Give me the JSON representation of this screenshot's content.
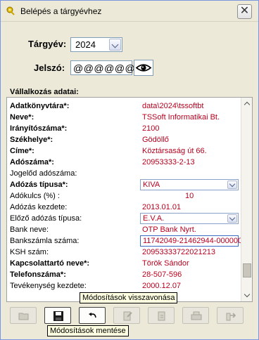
{
  "window": {
    "title": "Belépés a tárgyévhez",
    "close_label": "✕"
  },
  "login": {
    "year_label": "Tárgyév:",
    "year_value": "2024",
    "password_label": "Jelszó:",
    "password_value": "@@@@@@"
  },
  "company": {
    "section_label": "Vállalkozás adatai:",
    "fields": [
      {
        "label": "Adatkönyvtára*:",
        "value": "data\\2024\\tssoftbt"
      },
      {
        "label": "Neve*:",
        "value": "TSSoft Informatikai Bt."
      },
      {
        "label": "Irányítószáma*:",
        "value": "2100"
      },
      {
        "label": "Székhelye*:",
        "value": "Gödöllő"
      },
      {
        "label": "Címe*:",
        "value": "Köztársaság út 66."
      },
      {
        "label": "Adószáma*:",
        "value": "20953333-2-13"
      },
      {
        "label": "Jogelőd adószáma:",
        "value": ""
      },
      {
        "label": "Adózás típusa*:",
        "value": "KIVA"
      },
      {
        "label": "Adókulcs (%) :",
        "value": "10"
      },
      {
        "label": "Adózás kezdete:",
        "value": "2013.01.01"
      },
      {
        "label": "Előző adózás típusa:",
        "value": "E.V.A."
      },
      {
        "label": "Bank neve:",
        "value": "OTP Bank Nyrt."
      },
      {
        "label": "Bankszámla száma:",
        "value": "11742049-21462944-000000"
      },
      {
        "label": "KSH szám:",
        "value": "20953333722021213"
      },
      {
        "label": "Kapcsolattartó neve*:",
        "value": "Török Sándor"
      },
      {
        "label": "Telefonszáma*:",
        "value": "28-507-596"
      },
      {
        "label": "Tevékenység kezdete:",
        "value": "2000.12.07"
      }
    ]
  },
  "tooltips": {
    "revert": "Módosítások visszavonása",
    "save": "Módosítások mentése"
  },
  "toolbar": {
    "buttons": [
      {
        "icon": "open-folder-icon",
        "enabled": false
      },
      {
        "icon": "save-floppy-icon",
        "enabled": true
      },
      {
        "icon": "undo-arrow-icon",
        "enabled": true
      },
      {
        "icon": "edit-document-icon",
        "enabled": false
      },
      {
        "icon": "import-icon",
        "enabled": false
      },
      {
        "icon": "print-icon",
        "enabled": false
      },
      {
        "icon": "export-icon",
        "enabled": false
      }
    ]
  },
  "colors": {
    "value_red": "#b8001e",
    "window_bg": "#ece9d8",
    "tooltip_bg": "#ffffe1"
  }
}
